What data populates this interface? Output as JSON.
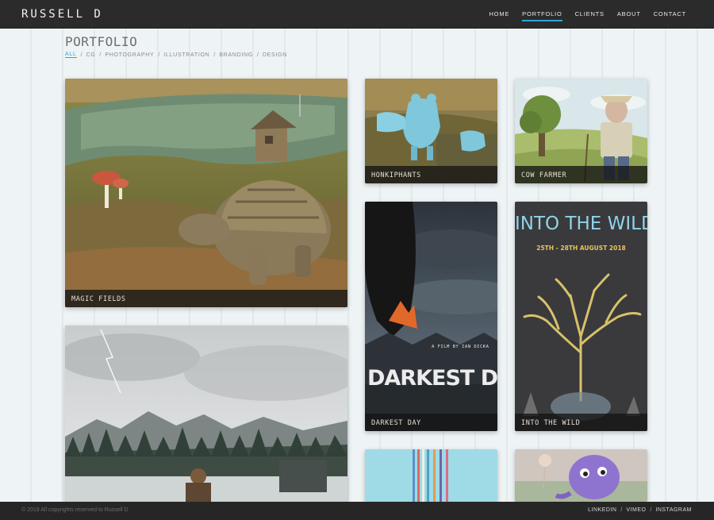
{
  "header": {
    "brand": "RUSSELL D",
    "nav": [
      {
        "label": "HOME",
        "active": false
      },
      {
        "label": "PORTFOLIO",
        "active": true
      },
      {
        "label": "CLIENTS",
        "active": false
      },
      {
        "label": "ABOUT",
        "active": false
      },
      {
        "label": "CONTACT",
        "active": false
      }
    ],
    "accent_color": "#2aa7d8"
  },
  "page": {
    "title": "PORTFOLIO",
    "filters": [
      "ALL",
      "CG",
      "PHOTOGRAPHY",
      "ILLUSTRATION",
      "BRANDING",
      "DESIGN"
    ],
    "separator": "/"
  },
  "tiles": [
    {
      "caption": "MAGIC FIELDS"
    },
    {
      "caption": "HONKIPHANTS"
    },
    {
      "caption": "COW FARMER"
    },
    {
      "caption": "DARKEST DAY",
      "poster_text": "DARKEST DAY",
      "poster_credit": "A FILM BY IAN DICKA"
    },
    {
      "caption": "INTO THE WILD",
      "poster_title": "INTO THE WILD",
      "poster_dates": "25TH - 28TH AUGUST 2018"
    },
    {
      "caption": ""
    },
    {
      "caption": ""
    },
    {
      "caption": ""
    }
  ],
  "footer": {
    "copyright": "© 2019 All copyrights reserved to Russell D",
    "social": [
      "LINKEDIN",
      "VIMEO",
      "INSTAGRAM"
    ]
  }
}
